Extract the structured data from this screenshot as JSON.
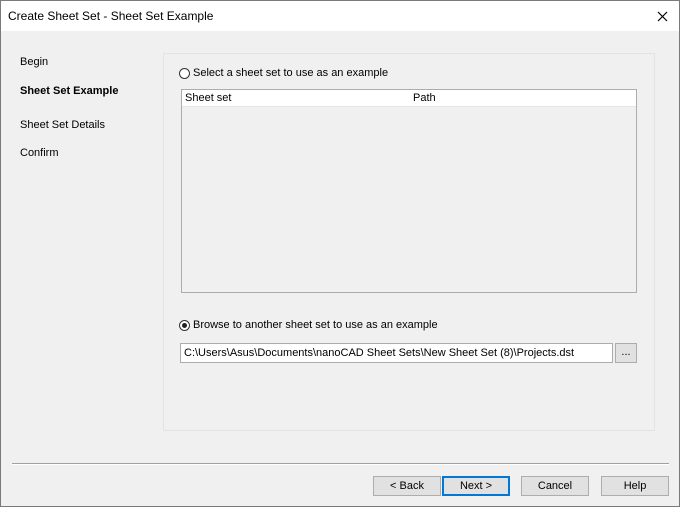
{
  "window": {
    "title": "Create Sheet Set - Sheet Set Example"
  },
  "nav": {
    "items": [
      {
        "label": "Begin"
      },
      {
        "label": "Sheet Set Example"
      },
      {
        "label": "Sheet Set Details"
      },
      {
        "label": "Confirm"
      }
    ],
    "active_label": "Sheet Set Example"
  },
  "options": {
    "select_example": {
      "label": "Select a sheet set to use as an example",
      "checked": false
    },
    "browse_example": {
      "label": "Browse to another sheet set to use as an example",
      "checked": true
    }
  },
  "sheet_set_list": {
    "columns": [
      "Sheet set",
      "Path"
    ],
    "rows": []
  },
  "browse": {
    "path_value": "C:\\Users\\Asus\\Documents\\nanoCAD Sheet Sets\\New Sheet Set (8)\\Projects.dst",
    "button_label": "..."
  },
  "footer": {
    "back_label": "< Back",
    "next_label": "Next >",
    "cancel_label": "Cancel",
    "help_label": "Help"
  },
  "icons": {
    "close": "close-icon"
  }
}
